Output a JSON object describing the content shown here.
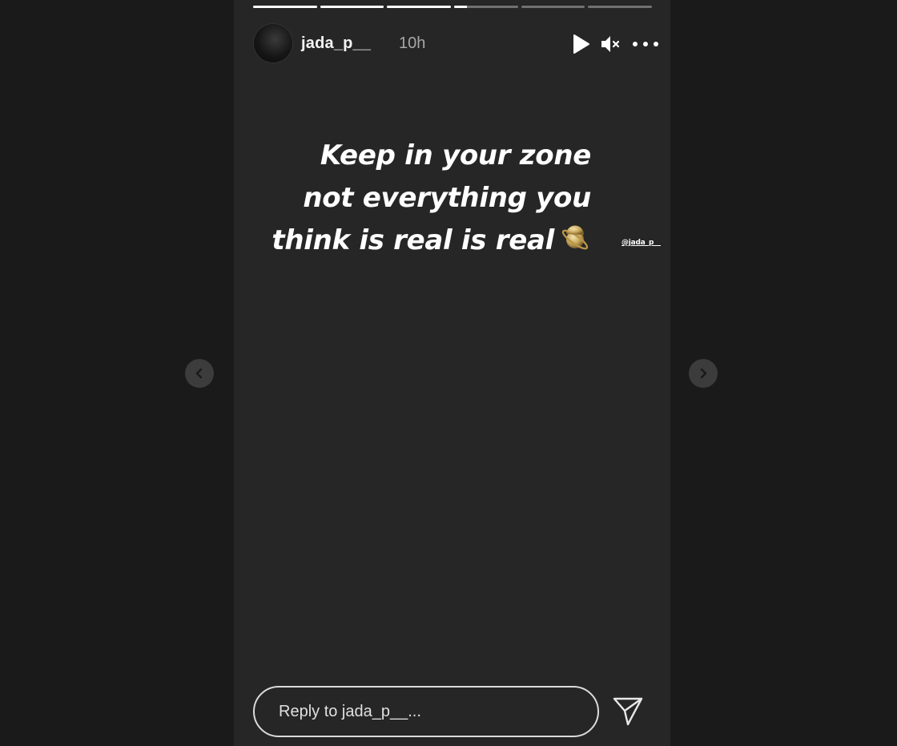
{
  "story": {
    "progress": [
      1,
      1,
      1,
      0.2,
      0,
      0
    ],
    "user": {
      "username": "jada_p__",
      "time_ago": "10h"
    },
    "controls": {
      "play_icon": "play-icon",
      "mute_icon": "muted-speaker-icon",
      "more_icon": "more-options-icon"
    },
    "caption": {
      "lines": [
        "Keep in your zone",
        "not everything you",
        "think is real is real"
      ],
      "emoji": "ringed-planet-emoji"
    },
    "mention": "@jada_p__"
  },
  "reply": {
    "placeholder": "Reply to jada_p__..."
  },
  "navigation": {
    "prev_icon": "chevron-left-icon",
    "next_icon": "chevron-right-icon"
  }
}
